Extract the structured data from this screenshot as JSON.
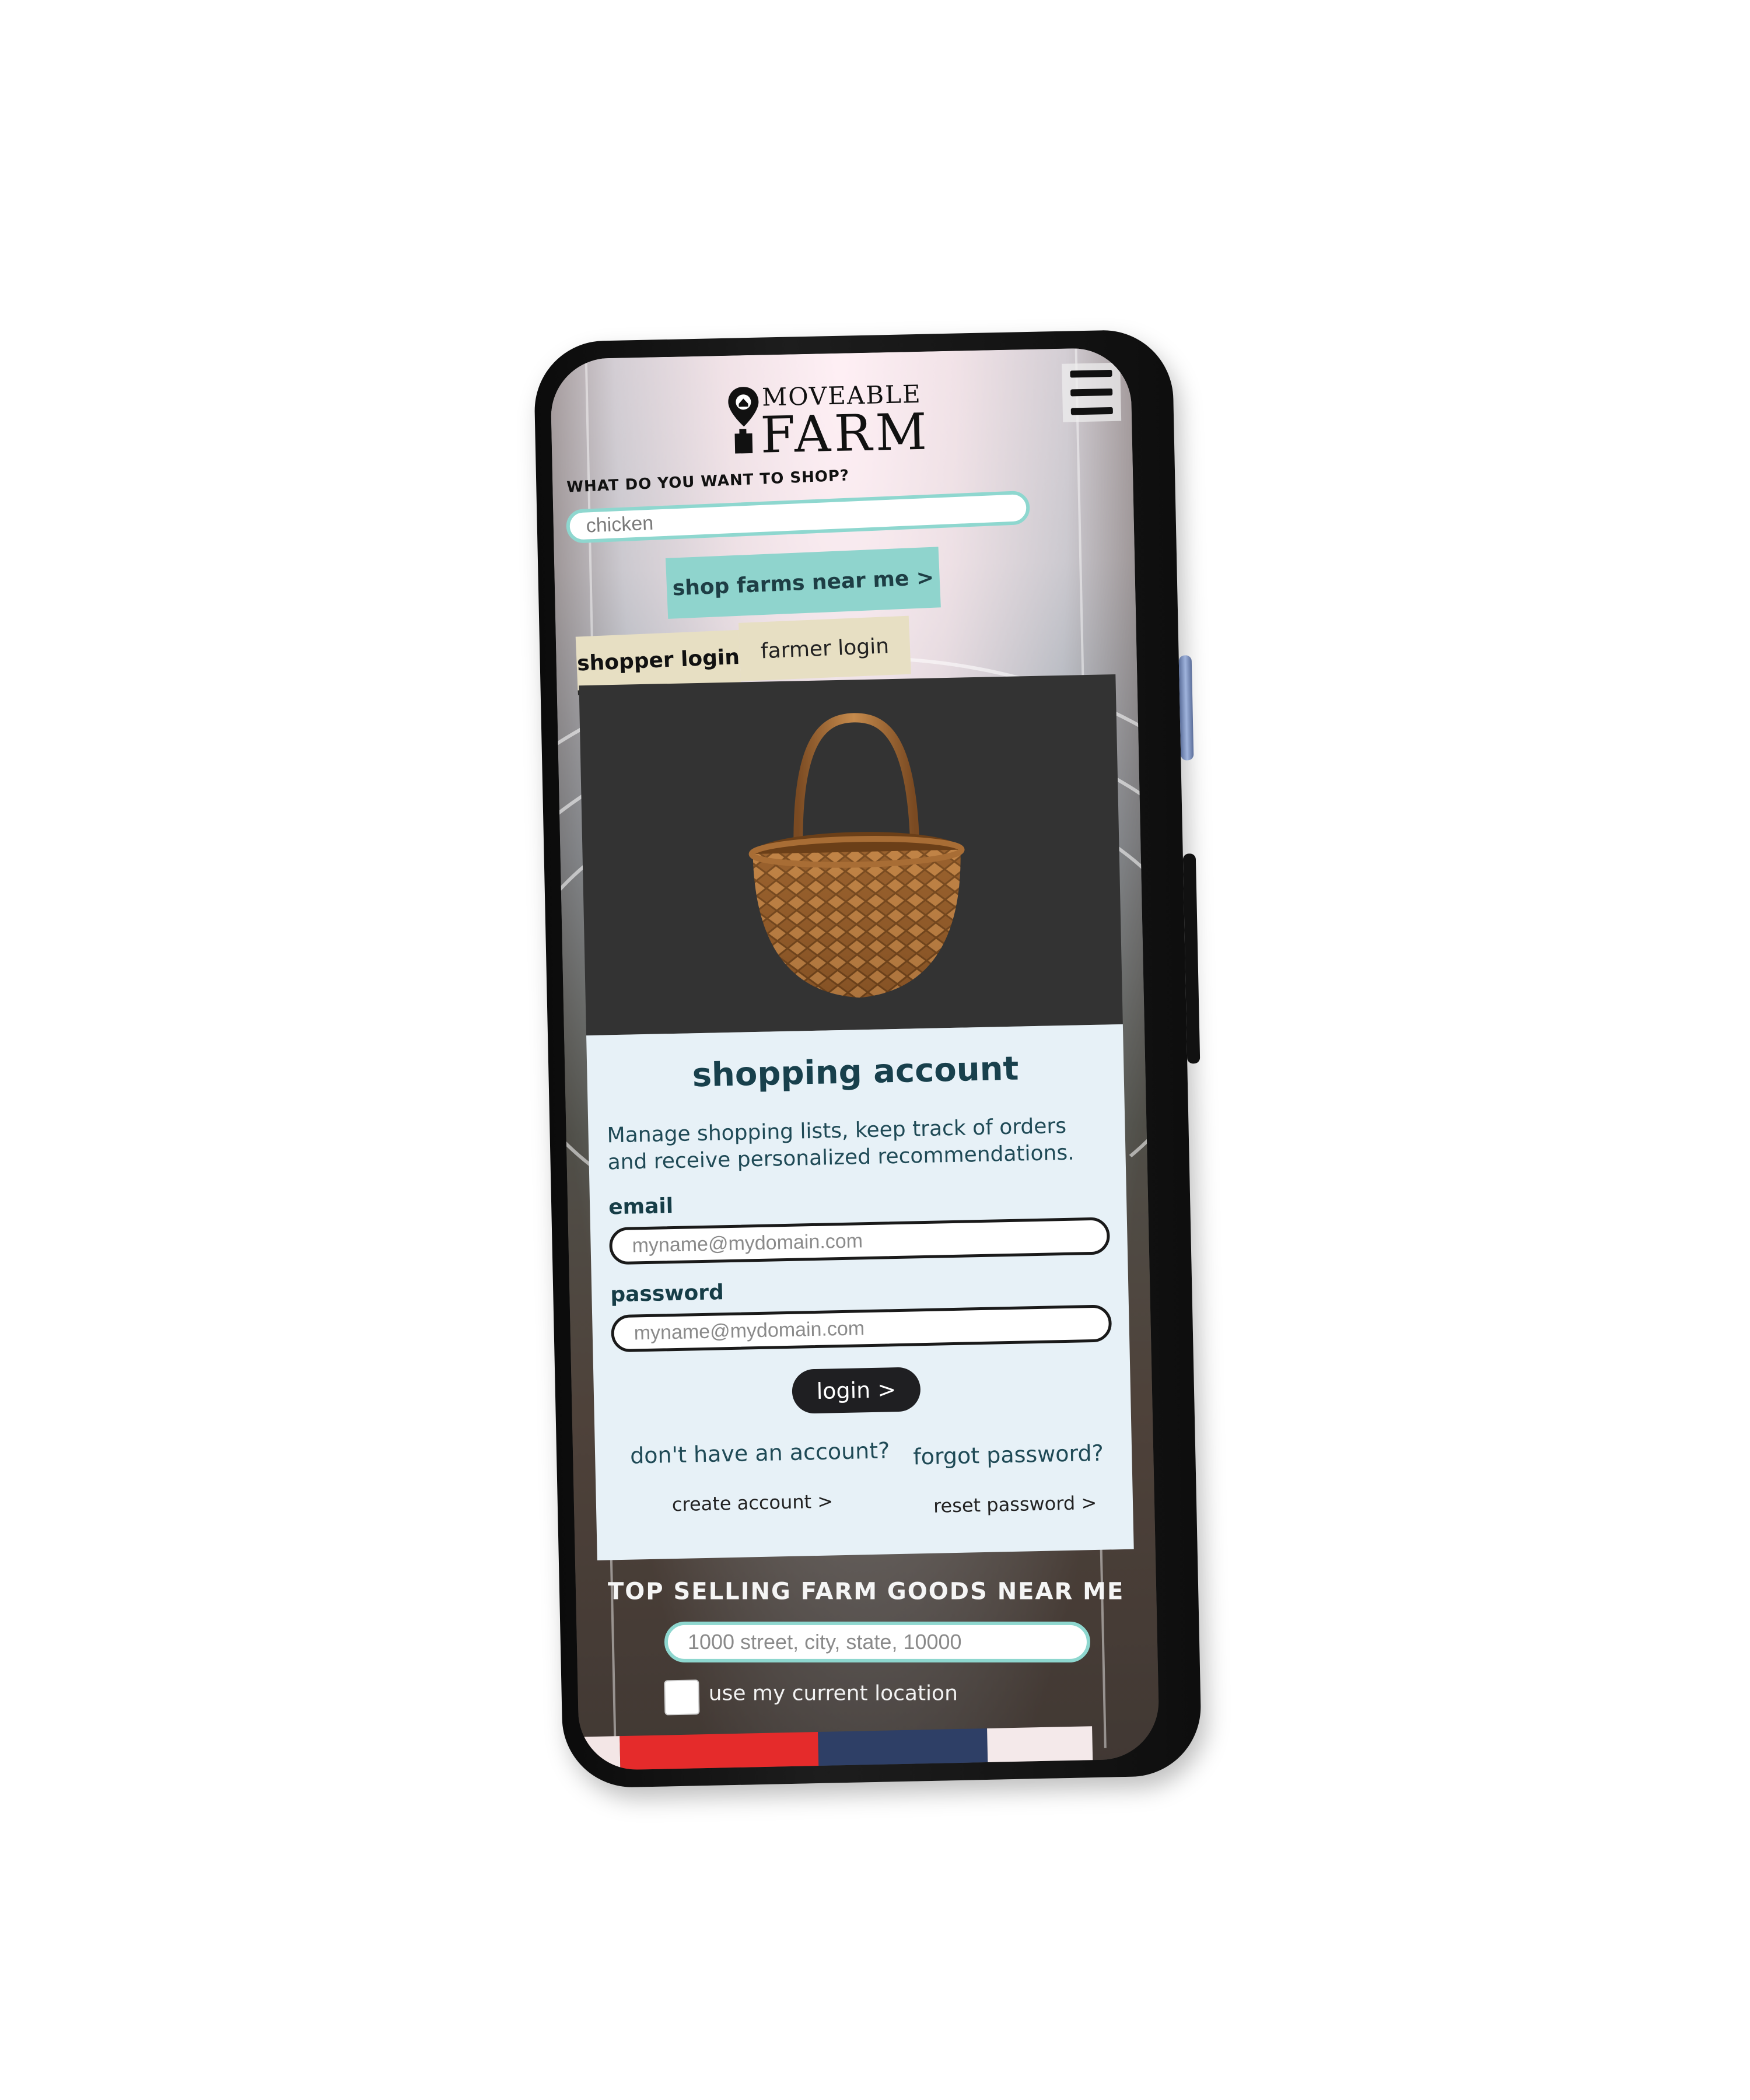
{
  "brand": {
    "logo_top": "MOVEABLE",
    "logo_bottom": "FARM"
  },
  "search": {
    "question": "WHAT DO YOU WANT TO SHOP?",
    "placeholder": "chicken",
    "button_label": "shop farms near me >"
  },
  "tabs": [
    {
      "label": "shopper login",
      "active": true
    },
    {
      "label": "farmer login",
      "active": false
    }
  ],
  "account": {
    "title": "shopping account",
    "description": "Manage shopping lists, keep track of orders and receive personalized recommendations.",
    "email_label": "email",
    "email_placeholder": "myname@mydomain.com",
    "password_label": "password",
    "password_placeholder": "myname@mydomain.com",
    "login_label": "login  >",
    "no_account_text": "don't have an account?",
    "create_account_link": "create account >",
    "forgot_text": "forgot password?",
    "reset_link": "reset password >"
  },
  "nearby": {
    "heading": "TOP SELLING FARM GOODS NEAR ME",
    "address_placeholder": "1000 street, city, state, 10000",
    "location_label": "use my current location"
  },
  "colors": {
    "accent_teal": "#8fd4cd",
    "tab_beige": "#e7dfc3",
    "panel_bg": "#e7f1f7",
    "heading_text": "#18404c",
    "dark_hero": "#333333"
  },
  "icons": {
    "menu": "hamburger-menu-icon",
    "logo_pin": "map-pin-icon",
    "basket": "basket-image"
  }
}
